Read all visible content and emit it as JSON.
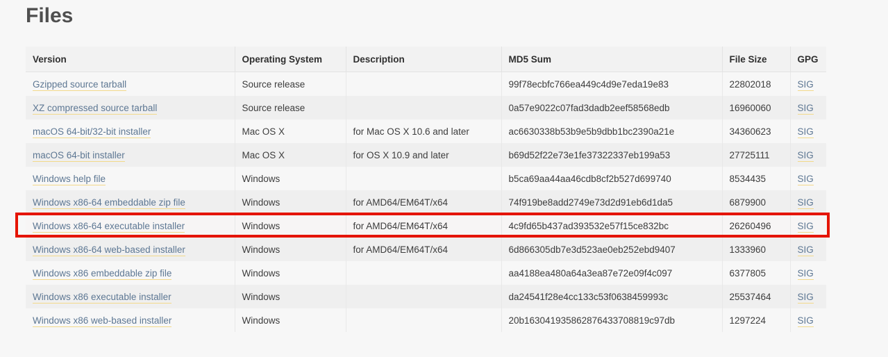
{
  "page": {
    "title": "Files",
    "accent_highlight_color": "#e51400",
    "link_color": "#5d7793",
    "link_underline_color": "#f2d98a",
    "background_color": "#f7f7f7"
  },
  "table": {
    "columns": [
      {
        "key": "version",
        "label": "Version"
      },
      {
        "key": "os",
        "label": "Operating System"
      },
      {
        "key": "description",
        "label": "Description"
      },
      {
        "key": "md5",
        "label": "MD5 Sum"
      },
      {
        "key": "size",
        "label": "File Size"
      },
      {
        "key": "gpg",
        "label": "GPG"
      }
    ],
    "gpg_link_label": "SIG",
    "rows": [
      {
        "version": "Gzipped source tarball",
        "os": "Source release",
        "description": "",
        "md5": "99f78ecbfc766ea449c4d9e7eda19e83",
        "size": "22802018",
        "gpg": "SIG",
        "highlighted": false
      },
      {
        "version": "XZ compressed source tarball",
        "os": "Source release",
        "description": "",
        "md5": "0a57e9022c07fad3dadb2eef58568edb",
        "size": "16960060",
        "gpg": "SIG",
        "highlighted": false
      },
      {
        "version": "macOS 64-bit/32-bit installer",
        "os": "Mac OS X",
        "description": "for Mac OS X 10.6 and later",
        "md5": "ac6630338b53b9e5b9dbb1bc2390a21e",
        "size": "34360623",
        "gpg": "SIG",
        "highlighted": false
      },
      {
        "version": "macOS 64-bit installer",
        "os": "Mac OS X",
        "description": "for OS X 10.9 and later",
        "md5": "b69d52f22e73e1fe37322337eb199a53",
        "size": "27725111",
        "gpg": "SIG",
        "highlighted": false
      },
      {
        "version": "Windows help file",
        "os": "Windows",
        "description": "",
        "md5": "b5ca69aa44aa46cdb8cf2b527d699740",
        "size": "8534435",
        "gpg": "SIG",
        "highlighted": false
      },
      {
        "version": "Windows x86-64 embeddable zip file",
        "os": "Windows",
        "description": "for AMD64/EM64T/x64",
        "md5": "74f919be8add2749e73d2d91eb6d1da5",
        "size": "6879900",
        "gpg": "SIG",
        "highlighted": false
      },
      {
        "version": "Windows x86-64 executable installer",
        "os": "Windows",
        "description": "for AMD64/EM64T/x64",
        "md5": "4c9fd65b437ad393532e57f15ce832bc",
        "size": "26260496",
        "gpg": "SIG",
        "highlighted": true
      },
      {
        "version": "Windows x86-64 web-based installer",
        "os": "Windows",
        "description": "for AMD64/EM64T/x64",
        "md5": "6d866305db7e3d523ae0eb252ebd9407",
        "size": "1333960",
        "gpg": "SIG",
        "highlighted": false
      },
      {
        "version": "Windows x86 embeddable zip file",
        "os": "Windows",
        "description": "",
        "md5": "aa4188ea480a64a3ea87e72e09f4c097",
        "size": "6377805",
        "gpg": "SIG",
        "highlighted": false
      },
      {
        "version": "Windows x86 executable installer",
        "os": "Windows",
        "description": "",
        "md5": "da24541f28e4cc133c53f0638459993c",
        "size": "25537464",
        "gpg": "SIG",
        "highlighted": false
      },
      {
        "version": "Windows x86 web-based installer",
        "os": "Windows",
        "description": "",
        "md5": "20b163041935862876433708819c97db",
        "size": "1297224",
        "gpg": "SIG",
        "highlighted": false
      }
    ]
  }
}
